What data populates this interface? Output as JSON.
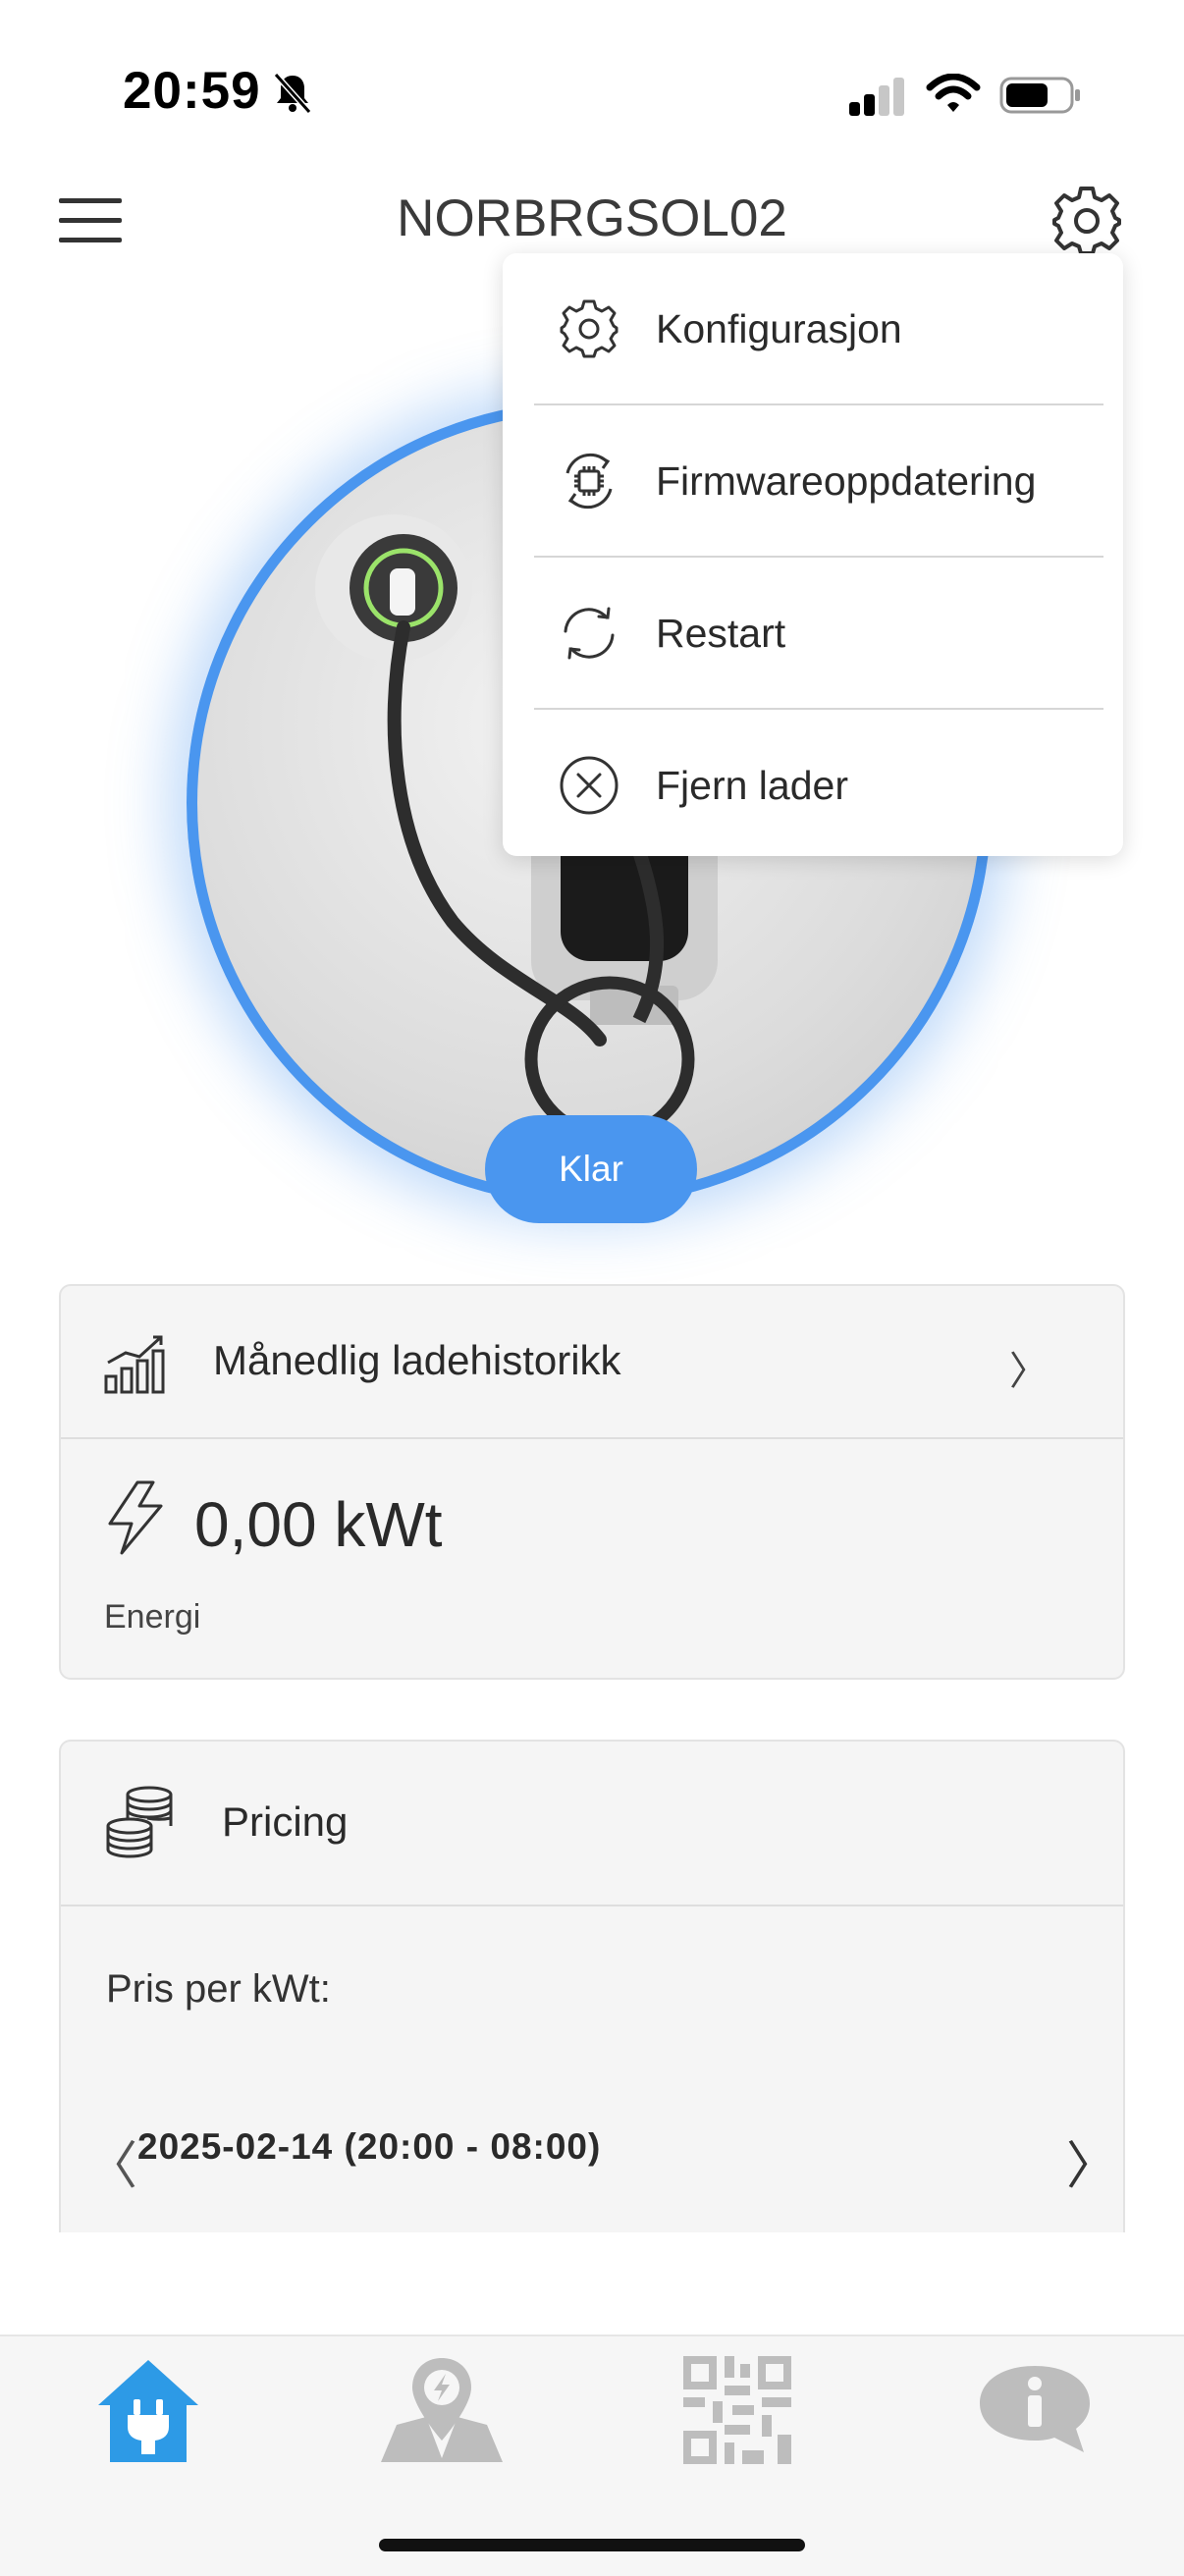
{
  "status_bar": {
    "time": "20:59"
  },
  "header": {
    "title": "NORBRGSOL02"
  },
  "settings_menu": {
    "items": [
      {
        "label": "Konfigurasjon",
        "icon": "gear-icon"
      },
      {
        "label": "Firmwareoppdatering",
        "icon": "chip-refresh-icon"
      },
      {
        "label": "Restart",
        "icon": "restart-icon"
      },
      {
        "label": "Fjern lader",
        "icon": "close-circle-icon"
      }
    ]
  },
  "charger": {
    "status_label": "Klar",
    "accent_color": "#4a96ef"
  },
  "history_card": {
    "title": "Månedlig ladehistorikk",
    "energy_value": "0,00 kWt",
    "energy_label": "Energi"
  },
  "pricing_card": {
    "title": "Pricing",
    "price_per_label": "Pris per kWt:",
    "period": "2025-02-14 (20:00 - 08:00)",
    "prev_symbol": "〈",
    "next_symbol": "〉"
  },
  "bottom_nav": {
    "items": [
      {
        "icon": "home-plug-icon",
        "active": true
      },
      {
        "icon": "map-charge-icon",
        "active": false
      },
      {
        "icon": "qr-code-icon",
        "active": false
      },
      {
        "icon": "info-bubble-icon",
        "active": false
      }
    ],
    "active_color": "#2d9ae6",
    "inactive_color": "#bdbdbd"
  }
}
